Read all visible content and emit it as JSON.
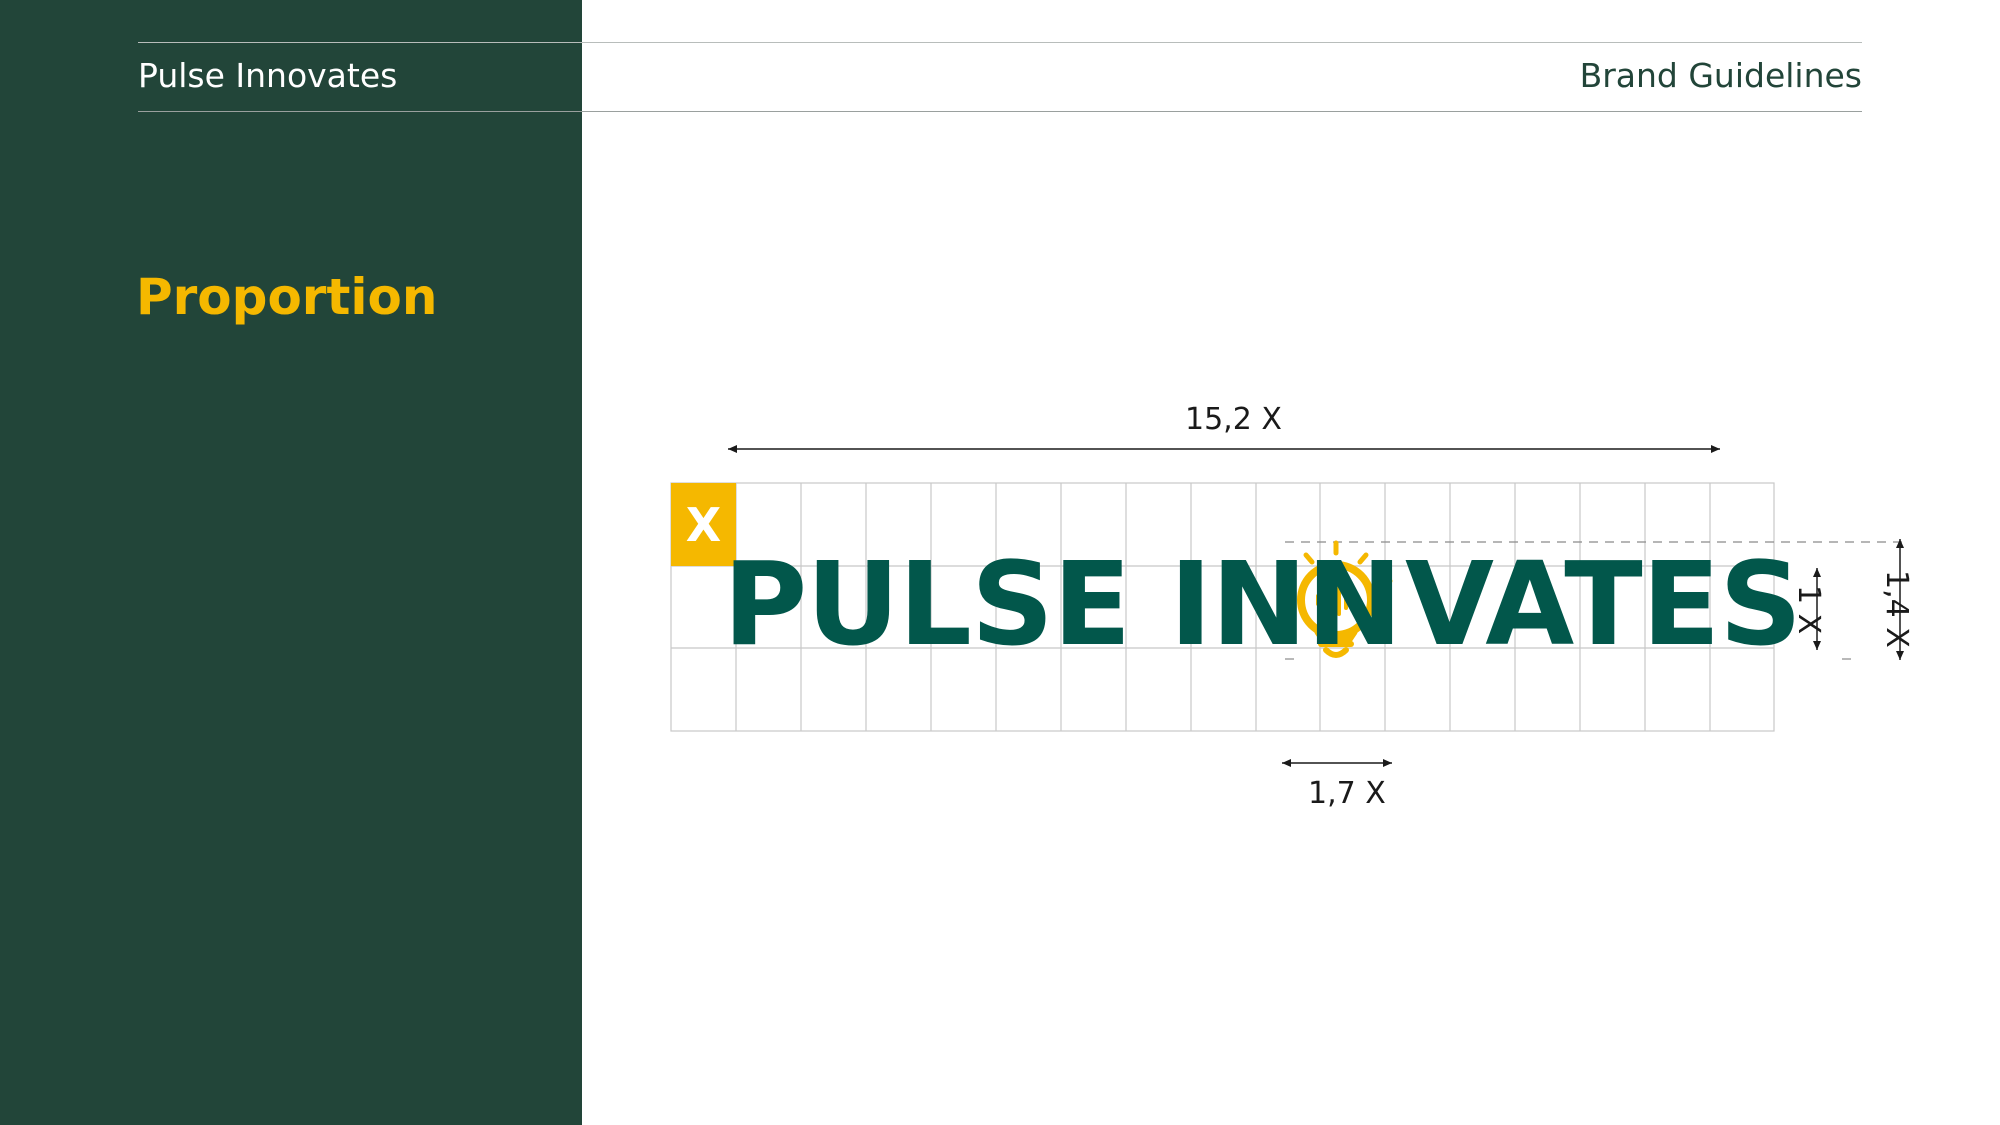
{
  "header": {
    "brand": "Pulse Innovates",
    "document_title": "Brand Guidelines"
  },
  "section": {
    "title": "Proportion"
  },
  "logo": {
    "word_left": "PULSE INN",
    "word_right": "VATES",
    "unit_marker": "X",
    "bulb": "lightbulb-pulse-icon"
  },
  "dimensions": {
    "width_label": "15,2 X",
    "bulb_width_label": "1,7 X",
    "cap_height_label": "1 X",
    "total_height_label": "1,4 X"
  },
  "colors": {
    "sidebar": "#224539",
    "accent": "#f5b800",
    "logo_green": "#02574b",
    "grid_line": "#c8c8c8"
  }
}
